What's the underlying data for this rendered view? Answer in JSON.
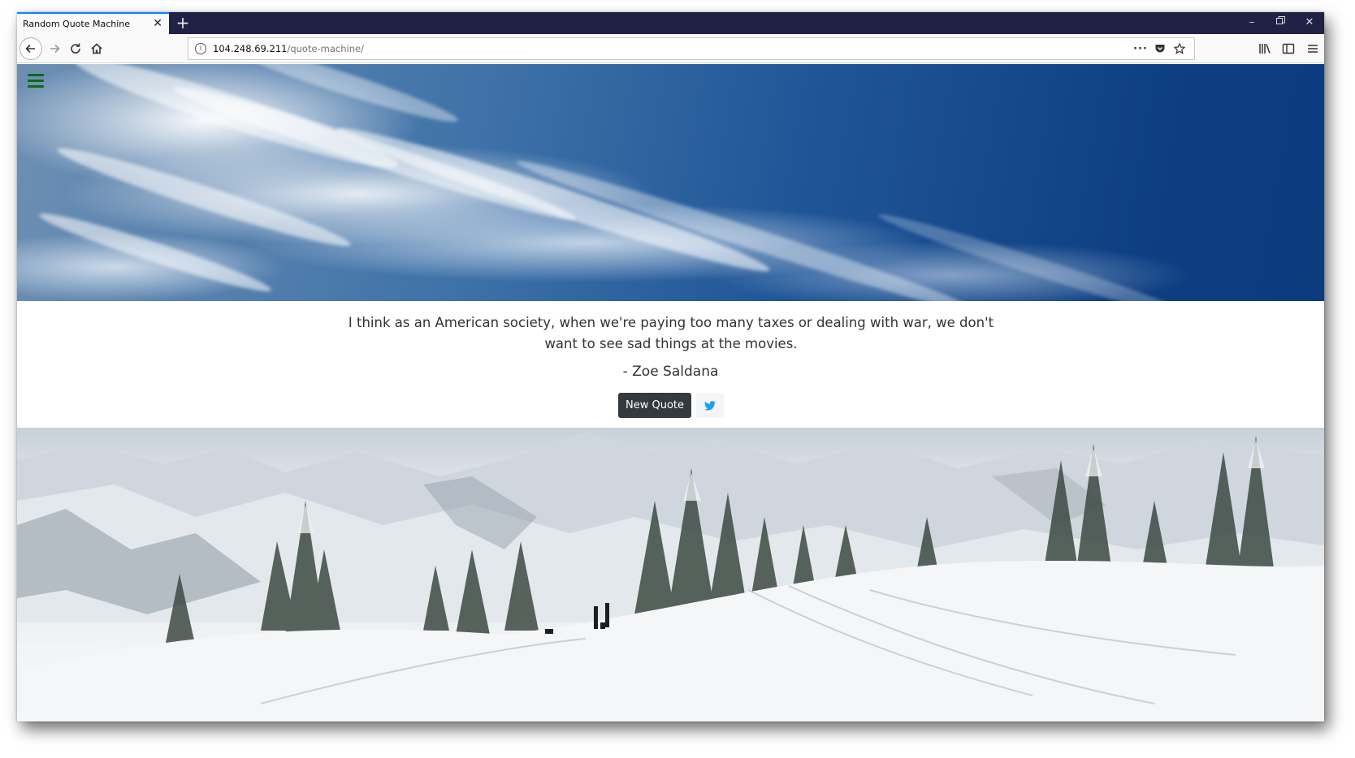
{
  "browser": {
    "tab_title": "Random Quote Machine",
    "url_host": "104.248.69.211",
    "url_path": "/quote-machine/"
  },
  "quote": {
    "text": "I think as an American society, when we're paying too many taxes or dealing with war, we don't want to see sad things at the movies.",
    "author": "- Zoe Saldana",
    "new_quote_label": "New Quote"
  },
  "colors": {
    "hamburger": "#0c6b12",
    "button_dark": "#343a40",
    "twitter": "#1da1f2",
    "tab_accent": "#0a84ff"
  }
}
